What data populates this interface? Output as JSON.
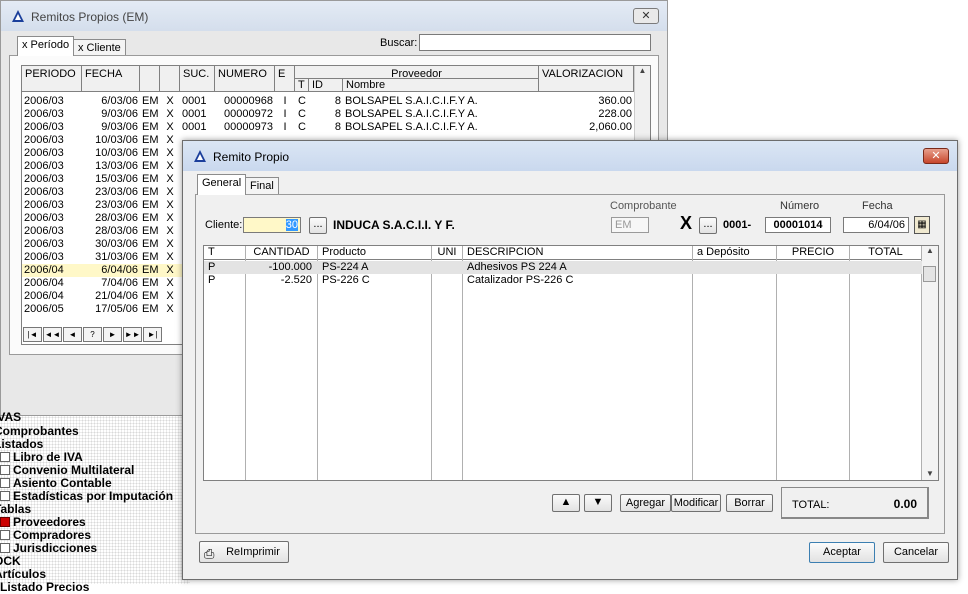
{
  "tree": [
    {
      "label": "IVAS",
      "indent": 0,
      "icon": ""
    },
    {
      "label": "Comprobantes",
      "indent": 0,
      "icon": ""
    },
    {
      "label": "Listados",
      "indent": 0,
      "icon": ""
    },
    {
      "label": "Libro de IVA",
      "indent": 1,
      "icon": "gear-icon"
    },
    {
      "label": "Convenio Multilateral",
      "indent": 1,
      "icon": "doc-icon"
    },
    {
      "label": "Asiento Contable",
      "indent": 1,
      "icon": "doc-icon"
    },
    {
      "label": "Estadísticas por Imputación",
      "indent": 1,
      "icon": "doc-icon"
    },
    {
      "label": "Tablas",
      "indent": 0,
      "icon": ""
    },
    {
      "label": "Proveedores",
      "indent": 1,
      "icon": "red-icon"
    },
    {
      "label": "Compradores",
      "indent": 1,
      "icon": "doc-icon"
    },
    {
      "label": "Jurisdicciones",
      "indent": 1,
      "icon": "doc-icon"
    },
    {
      "label": "OCK",
      "indent": 0,
      "icon": ""
    },
    {
      "label": "Artículos",
      "indent": 0,
      "icon": ""
    },
    {
      "label": "Listado Precios",
      "indent": 1,
      "icon": ""
    }
  ],
  "back": {
    "title": "Remitos Propios (EM)",
    "close": "✕",
    "tabs": [
      "x Período",
      "x Cliente"
    ],
    "search_label": "Buscar:",
    "search_value": "",
    "headers": [
      "PERIODO",
      "FECHA",
      "",
      "",
      "SUC.",
      "NUMERO",
      "E",
      "Proveedor",
      "VALORIZACION"
    ],
    "sub_headers": [
      "T",
      "ID",
      "Nombre"
    ],
    "rows": [
      [
        "2006/03",
        "6/03/06",
        "EM",
        "X",
        "0001",
        "00000968",
        "I",
        "C",
        "8",
        "BOLSAPEL S.A.I.C.I.F.Y A.",
        "360.00"
      ],
      [
        "2006/03",
        "9/03/06",
        "EM",
        "X",
        "0001",
        "00000972",
        "I",
        "C",
        "8",
        "BOLSAPEL S.A.I.C.I.F.Y A.",
        "228.00"
      ],
      [
        "2006/03",
        "9/03/06",
        "EM",
        "X",
        "0001",
        "00000973",
        "I",
        "C",
        "8",
        "BOLSAPEL S.A.I.C.I.F.Y A.",
        "2,060.00"
      ],
      [
        "2006/03",
        "10/03/06",
        "EM",
        "X",
        "",
        "",
        "",
        "",
        "",
        "",
        ""
      ],
      [
        "2006/03",
        "10/03/06",
        "EM",
        "X",
        "",
        "",
        "",
        "",
        "",
        "",
        ""
      ],
      [
        "2006/03",
        "13/03/06",
        "EM",
        "X",
        "",
        "",
        "",
        "",
        "",
        "",
        ""
      ],
      [
        "2006/03",
        "15/03/06",
        "EM",
        "X",
        "",
        "",
        "",
        "",
        "",
        "",
        ""
      ],
      [
        "2006/03",
        "23/03/06",
        "EM",
        "X",
        "",
        "",
        "",
        "",
        "",
        "",
        ""
      ],
      [
        "2006/03",
        "23/03/06",
        "EM",
        "X",
        "",
        "",
        "",
        "",
        "",
        "",
        ""
      ],
      [
        "2006/03",
        "28/03/06",
        "EM",
        "X",
        "",
        "",
        "",
        "",
        "",
        "",
        ""
      ],
      [
        "2006/03",
        "28/03/06",
        "EM",
        "X",
        "",
        "",
        "",
        "",
        "",
        "",
        ""
      ],
      [
        "2006/03",
        "30/03/06",
        "EM",
        "X",
        "",
        "",
        "",
        "",
        "",
        "",
        ""
      ],
      [
        "2006/03",
        "31/03/06",
        "EM",
        "X",
        "",
        "",
        "",
        "",
        "",
        "",
        ""
      ],
      [
        "2006/04",
        "6/04/06",
        "EM",
        "X",
        "",
        "",
        "",
        "",
        "",
        "",
        ""
      ],
      [
        "2006/04",
        "7/04/06",
        "EM",
        "X",
        "",
        "",
        "",
        "",
        "",
        "",
        ""
      ],
      [
        "2006/04",
        "21/04/06",
        "EM",
        "X",
        "",
        "",
        "",
        "",
        "",
        "",
        ""
      ],
      [
        "2006/05",
        "17/05/06",
        "EM",
        "X",
        "",
        "",
        "",
        "",
        "",
        "",
        ""
      ]
    ],
    "nav": [
      "|◄",
      "◄◄",
      "◄",
      "?",
      "►",
      "►►",
      "►|"
    ]
  },
  "front": {
    "title": "Remito Propio",
    "close": "✕",
    "tabs": [
      "General",
      "Final"
    ],
    "comprobante_label": "Comprobante",
    "numero_label": "Número",
    "fecha_label": "Fecha",
    "cliente_label": "Cliente:",
    "cliente_code": "30",
    "cliente_name": "INDUCA S.A.C.I.I. Y F.",
    "comprobante_value": "EM",
    "letter": "X",
    "pv": "0001-",
    "numero_value": "00001014",
    "fecha_value": "6/04/06",
    "dots": "...",
    "headers": [
      "T",
      "CANTIDAD",
      "Producto",
      "UNI",
      "DESCRIPCION",
      "a Depósito",
      "PRECIO",
      "TOTAL"
    ],
    "rows": [
      [
        "P",
        "-100.000",
        "PS-224 A",
        "",
        "Adhesivos PS 224 A",
        "",
        "",
        ""
      ],
      [
        "P",
        "-2.520",
        "PS-226 C",
        "",
        "Catalizador PS-226 C",
        "",
        "",
        ""
      ]
    ],
    "btn_agregar": "Agregar",
    "btn_modificar": "Modificar",
    "btn_borrar": "Borrar",
    "total_label": "TOTAL:",
    "total_value": "0.00",
    "btn_reimprimir": "ReImprimir",
    "btn_aceptar": "Aceptar",
    "btn_cancelar": "Cancelar"
  },
  "colors": {
    "highlight_row": "#e3e3e3",
    "yellow": "#fff8c8",
    "selected_text": "#3399ff"
  }
}
